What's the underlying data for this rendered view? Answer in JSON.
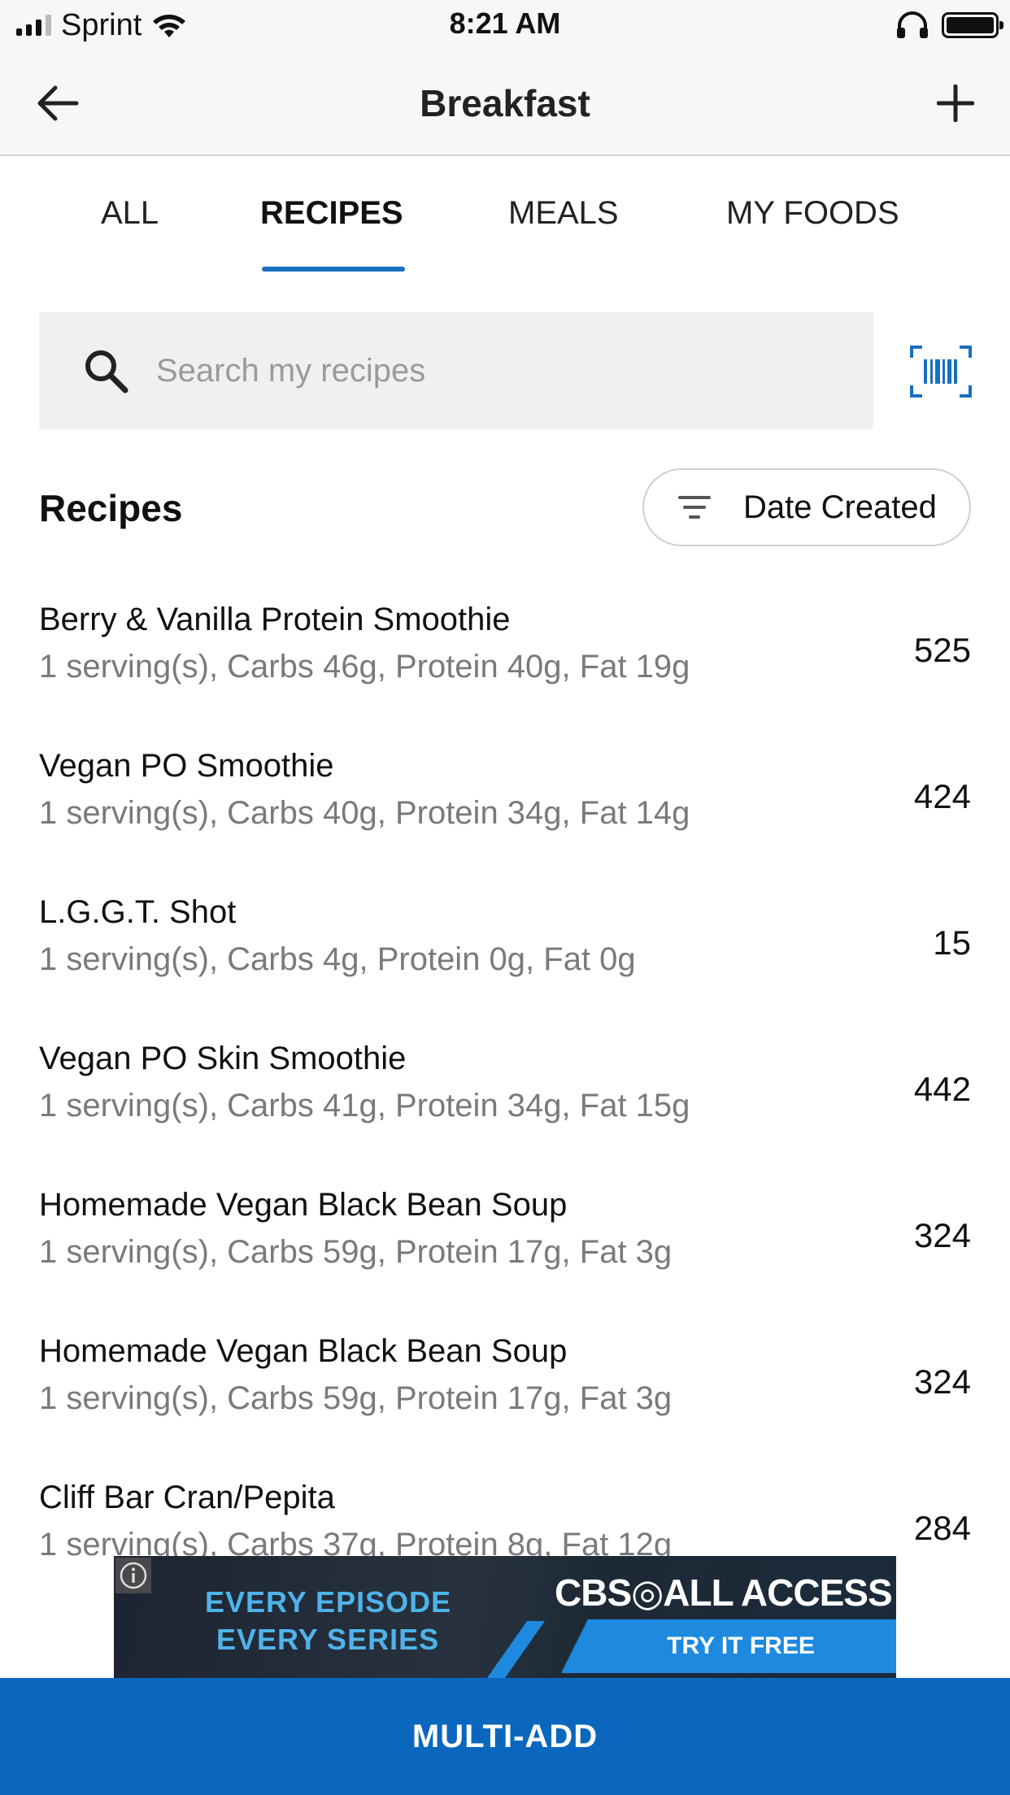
{
  "status_bar": {
    "carrier": "Sprint",
    "time": "8:21 AM"
  },
  "nav": {
    "title": "Breakfast"
  },
  "tabs": [
    {
      "label": "ALL"
    },
    {
      "label": "RECIPES"
    },
    {
      "label": "MEALS"
    },
    {
      "label": "MY FOODS"
    }
  ],
  "active_tab": "RECIPES",
  "search": {
    "placeholder": "Search my recipes",
    "value": ""
  },
  "section": {
    "title": "Recipes",
    "sort_label": "Date Created"
  },
  "recipes": [
    {
      "name": "Berry & Vanilla Protein Smoothie",
      "detail": "1 serving(s), Carbs 46g, Protein 40g, Fat 19g",
      "calories": "525"
    },
    {
      "name": "Vegan PO Smoothie",
      "detail": "1 serving(s), Carbs 40g, Protein 34g, Fat 14g",
      "calories": "424"
    },
    {
      "name": "L.G.G.T. Shot",
      "detail": "1 serving(s), Carbs 4g, Protein 0g, Fat 0g",
      "calories": "15"
    },
    {
      "name": "Vegan PO Skin Smoothie",
      "detail": "1 serving(s), Carbs 41g, Protein 34g, Fat 15g",
      "calories": "442"
    },
    {
      "name": "Homemade Vegan Black Bean Soup",
      "detail": "1 serving(s), Carbs 59g, Protein 17g, Fat 3g",
      "calories": "324"
    },
    {
      "name": "Homemade Vegan Black Bean Soup",
      "detail": "1 serving(s), Carbs 59g, Protein 17g, Fat 3g",
      "calories": "324"
    },
    {
      "name": "Cliff Bar Cran/Pepita",
      "detail": "1 serving(s), Carbs 37g, Protein 8g, Fat 12g",
      "calories": "284"
    }
  ],
  "ad": {
    "line1": "EVERY EPISODE",
    "line2": "EVERY SERIES",
    "brand": "CBS◎ALL ACCESS",
    "cta": "TRY IT FREE"
  },
  "footer": {
    "button_label": "MULTI-ADD"
  },
  "colors": {
    "accent": "#0b67bd",
    "tab_underline": "#1a6fc0",
    "secondary_text": "#7a7a7a"
  }
}
